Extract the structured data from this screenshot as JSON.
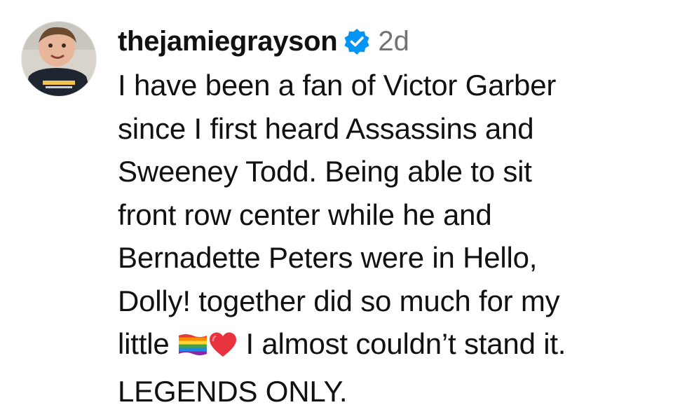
{
  "comment": {
    "avatar_icon": "user-avatar-icon",
    "username": "thejamiegrayson",
    "verified_icon": "verified-badge-icon",
    "verified_color": "#0095F6",
    "timestamp": "2d",
    "text_lines": [
      "I have been a fan of Victor Garber",
      "since I first heard Assassins and",
      "Sweeney Todd. Being able to sit",
      "front row center while he and",
      "Bernadette Peters were in Hello,",
      "Dolly! together did so much for my"
    ],
    "line7_before_emoji": "little ",
    "emoji_1": "rainbow-flag-icon",
    "emoji_2": "red-heart-icon",
    "line7_after_emoji": " I almost couldn’t stand it.",
    "line8": "LEGENDS ONLY."
  }
}
